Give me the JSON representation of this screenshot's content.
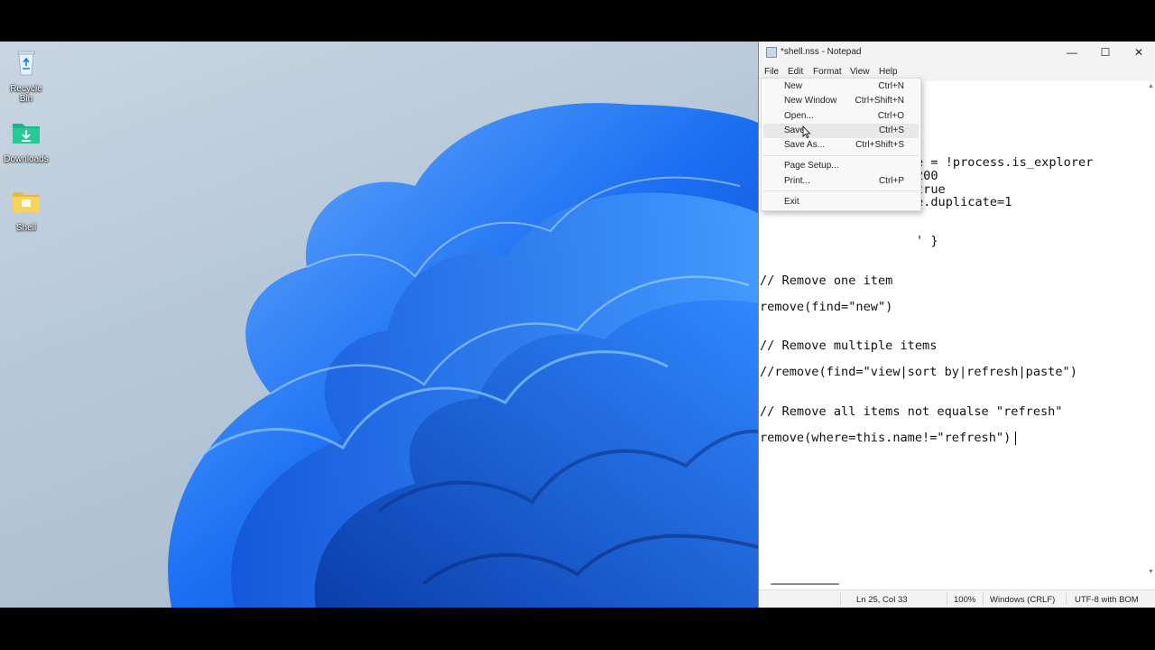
{
  "desktop": {
    "icons": [
      {
        "label": "Recycle Bin",
        "icon": "recycle-bin-icon"
      },
      {
        "label": "Downloads",
        "icon": "downloads-folder-icon"
      },
      {
        "label": "Shell",
        "icon": "folder-icon"
      }
    ],
    "wallpaper_colors": {
      "bloom": "#1a6ff0",
      "bloom_light": "#5aa8ff",
      "background": "#c0d0de"
    }
  },
  "notepad": {
    "title": "*shell.nss - Notepad",
    "window_buttons": {
      "minimize": "—",
      "maximize": "☐",
      "close": "✕"
    },
    "menu": [
      "File",
      "Edit",
      "Format",
      "View",
      "Help"
    ],
    "code_lines": [
      "e = !process.is_explorer",
      "200",
      "true",
      "e.duplicate=1",
      "' }",
      "// Remove one item",
      "remove(find=\"new\")",
      "// Remove multiple items",
      "//remove(find=\"view|sort by|refresh|paste\")",
      "// Remove all items not equalse \"refresh\"",
      "remove(where=this.name!=\"refresh\")"
    ],
    "status": {
      "position": "Ln 25, Col 33",
      "zoom": "100%",
      "line_ending": "Windows (CRLF)",
      "encoding": "UTF-8 with BOM"
    }
  },
  "file_menu": {
    "items": [
      {
        "label": "New",
        "shortcut": "Ctrl+N"
      },
      {
        "label": "New Window",
        "shortcut": "Ctrl+Shift+N"
      },
      {
        "label": "Open...",
        "shortcut": "Ctrl+O"
      },
      {
        "label": "Save",
        "shortcut": "Ctrl+S"
      },
      {
        "label": "Save As...",
        "shortcut": "Ctrl+Shift+S"
      },
      {
        "label": "Page Setup...",
        "shortcut": ""
      },
      {
        "label": "Print...",
        "shortcut": "Ctrl+P"
      },
      {
        "label": "Exit",
        "shortcut": ""
      }
    ],
    "hovered_item": "Save"
  }
}
